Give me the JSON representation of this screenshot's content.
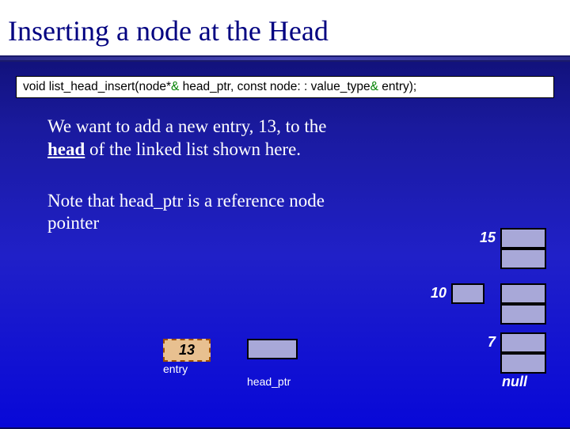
{
  "title": "Inserting a node at the Head",
  "code": {
    "prefix": "void list_head_insert(node*",
    "amp1": "&",
    "mid": " head_ptr, const node: : value_type",
    "amp2": "&",
    "suffix": " entry);"
  },
  "para1_a": "We want to add a new entry, 13, to the ",
  "para1_head": "head",
  "para1_b": " of the linked list shown here.",
  "para2": "Note that head_ptr is a reference node pointer",
  "nodes": {
    "n15": "15",
    "n10": "10",
    "n7": "7",
    "null": "null"
  },
  "entry_value": "13",
  "labels": {
    "entry": "entry",
    "head_ptr": "head_ptr"
  }
}
